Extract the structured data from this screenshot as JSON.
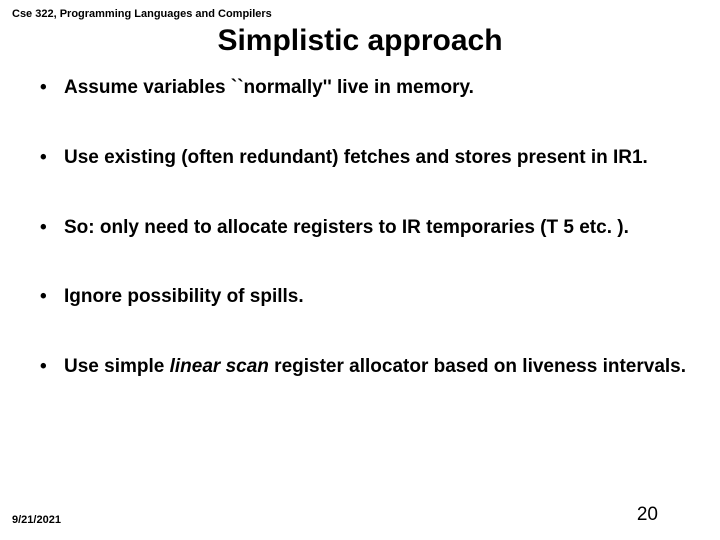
{
  "header": {
    "course": "Cse 322, Programming Languages and Compilers"
  },
  "title": "Simplistic approach",
  "bullets": [
    {
      "text": "Assume variables ``normally'' live in memory."
    },
    {
      "text": "Use existing (often redundant) fetches and stores present in IR1."
    },
    {
      "text": "So: only need to allocate registers to IR temporaries (T 5 etc. )."
    },
    {
      "text": "Ignore possibility of spills."
    },
    {
      "prefix": "Use simple ",
      "italic": "linear scan",
      "suffix": " register allocator based on liveness intervals."
    }
  ],
  "footer": {
    "date": "9/21/2021",
    "page": "20"
  }
}
